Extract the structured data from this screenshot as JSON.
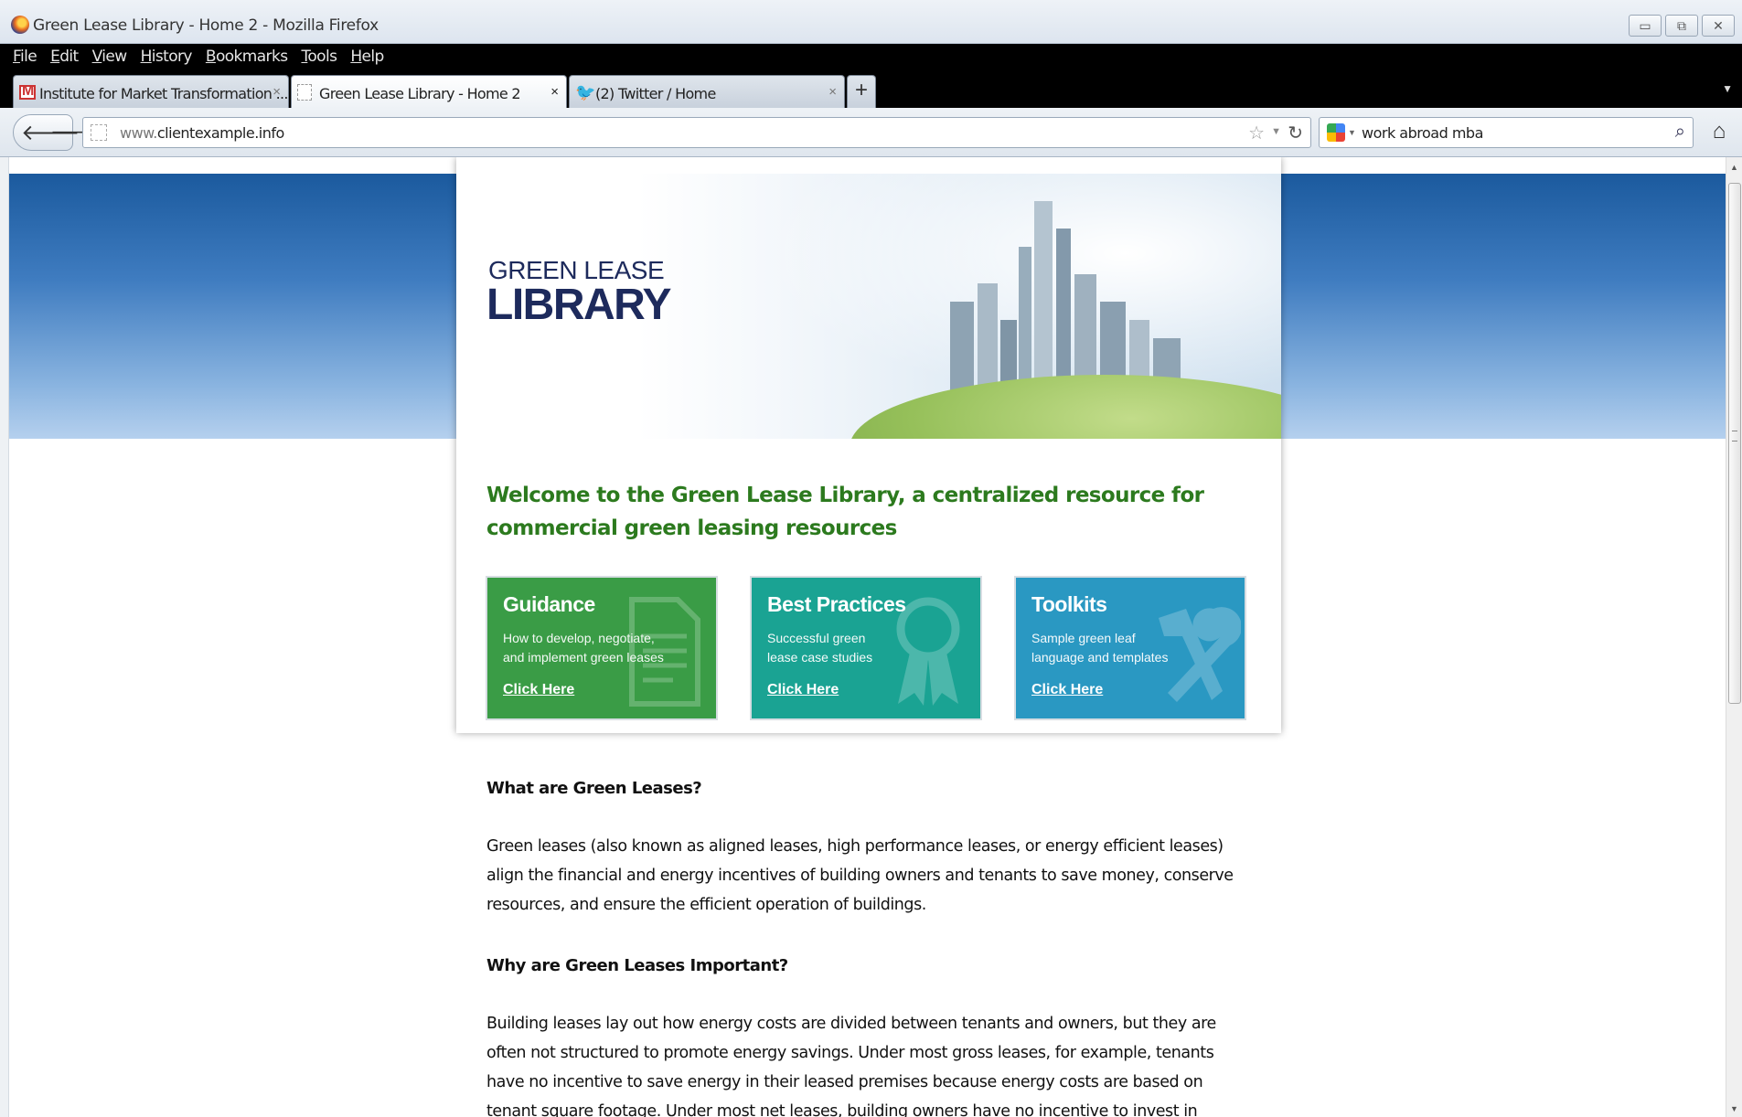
{
  "window": {
    "title": "Green Lease Library - Home 2 - Mozilla Firefox"
  },
  "menu": [
    "File",
    "Edit",
    "View",
    "History",
    "Bookmarks",
    "Tools",
    "Help"
  ],
  "tabs": [
    {
      "label": "Institute for Market Transformation ...",
      "icon": "gmail-icon",
      "active": false
    },
    {
      "label": "Green Lease Library - Home 2",
      "icon": "page-icon",
      "active": true
    },
    {
      "label": "(2) Twitter / Home",
      "icon": "twitter-icon",
      "active": false
    }
  ],
  "nav": {
    "url_prefix": "www.",
    "url_domain": "clientexample.info",
    "search_query": "work abroad mba"
  },
  "page": {
    "logo_line1": "GREEN LEASE",
    "logo_line2": "LIBRARY",
    "welcome": "Welcome to the Green Lease Library, a centralized resource for commercial green leasing resources",
    "cards": [
      {
        "title": "Guidance",
        "desc": "How to develop, negotiate, and implement green leases",
        "link": "Click Here",
        "color": "#3a9c46",
        "icon": "document-icon"
      },
      {
        "title": "Best Practices",
        "desc": "Successful green lease case studies",
        "link": "Click Here",
        "color": "#1aa393",
        "icon": "ribbon-icon"
      },
      {
        "title": "Toolkits",
        "desc": "Sample green leaf language and templates",
        "link": "Click Here",
        "color": "#2a98c2",
        "icon": "tools-icon"
      }
    ],
    "q1": "What are Green Leases?",
    "a1": "Green leases (also known as aligned leases, high performance leases, or energy efficient leases) align the financial and energy incentives of building owners and tenants to save money, conserve resources, and ensure the efficient operation of buildings.",
    "q2": "Why are Green Leases Important?",
    "a2": "Building leases lay out how energy costs are divided between tenants and owners, but they are often not structured to promote energy savings. Under most gross leases, for example, tenants have no incentive to save energy in their leased premises because energy costs are based on tenant square footage. Under most net leases, building owners have no incentive to invest in efficiency for their building systems because the"
  }
}
